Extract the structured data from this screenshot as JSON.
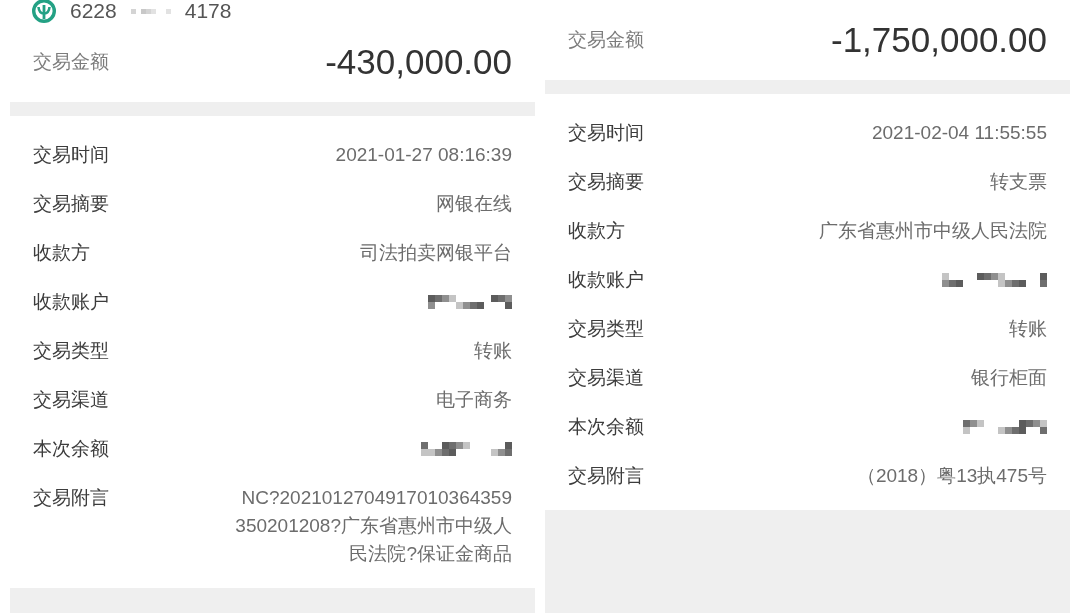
{
  "panels": [
    {
      "account": {
        "parts": [
          {
            "kind": "text",
            "value": "6228"
          },
          {
            "kind": "masked"
          },
          {
            "kind": "text",
            "value": "4178"
          }
        ]
      },
      "amount": {
        "label": "交易金额",
        "value": "-430,000.00"
      },
      "details": [
        {
          "label": "交易时间",
          "kind": "text",
          "value": "2021-01-27 08:16:39"
        },
        {
          "label": "交易摘要",
          "kind": "text",
          "value": "网银在线"
        },
        {
          "label": "收款方",
          "kind": "text",
          "value": "司法拍卖网银平台"
        },
        {
          "label": "收款账户",
          "kind": "masked"
        },
        {
          "label": "交易类型",
          "kind": "text",
          "value": "转账"
        },
        {
          "label": "交易渠道",
          "kind": "text",
          "value": "电子商务"
        },
        {
          "label": "本次余额",
          "kind": "masked"
        },
        {
          "label": "交易附言",
          "kind": "text",
          "value": "NC?2021012704917010364359350201208?广东省惠州市中级人民法院?保证金商品"
        }
      ]
    },
    {
      "amount": {
        "label": "交易金额",
        "value": "-1,750,000.00"
      },
      "details": [
        {
          "label": "交易时间",
          "kind": "text",
          "value": "2021-02-04 11:55:55"
        },
        {
          "label": "交易摘要",
          "kind": "text",
          "value": "转支票"
        },
        {
          "label": "收款方",
          "kind": "text",
          "value": "广东省惠州市中级人民法院"
        },
        {
          "label": "收款账户",
          "kind": "masked"
        },
        {
          "label": "交易类型",
          "kind": "text",
          "value": "转账"
        },
        {
          "label": "交易渠道",
          "kind": "text",
          "value": "银行柜面"
        },
        {
          "label": "本次余额",
          "kind": "masked"
        },
        {
          "label": "交易附言",
          "kind": "text",
          "value": "（2018）粤13执475号"
        }
      ]
    }
  ]
}
